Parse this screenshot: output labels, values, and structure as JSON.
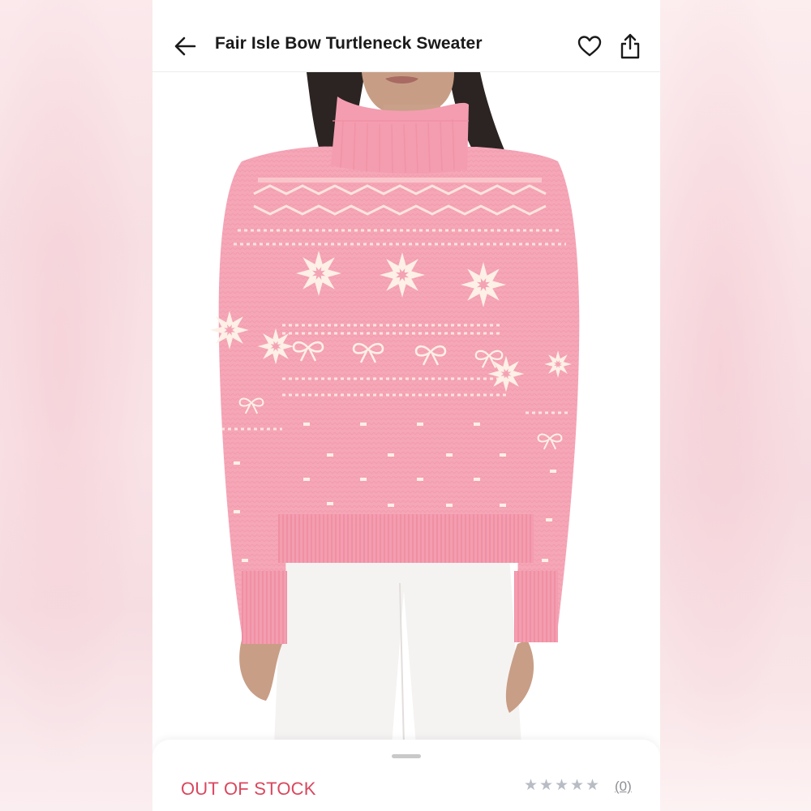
{
  "header": {
    "title": "Fair Isle Bow Turtleneck Sweater"
  },
  "product": {
    "image_alt": "Model wearing a pink fair isle turtleneck sweater with snowflake and bow motifs and white pants",
    "availability": "OUT OF STOCK",
    "rating_count": "(0)",
    "rating_stars": 0,
    "rating_max": 5
  },
  "icons": {
    "back": "arrow-left-icon",
    "favorite": "heart-outline-icon",
    "share": "share-icon",
    "star": "star-icon"
  },
  "colors": {
    "status_red": "#d9475e",
    "sweater_pink": "#f4a3b4",
    "pattern_cream": "#fdf0e6",
    "star_grey": "#b8bcc4"
  }
}
